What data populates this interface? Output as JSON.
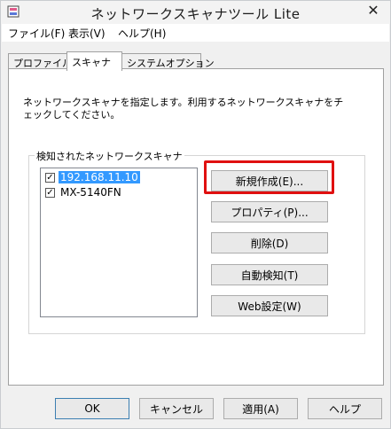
{
  "window": {
    "title": "ネットワークスキャナツール Lite",
    "close_glyph": "✕"
  },
  "menu": [
    "ファイル(F)",
    "表示(V)",
    "ヘルプ(H)"
  ],
  "tabs": [
    "プロファイル",
    "スキャナ",
    "システムオプション"
  ],
  "active_tab": "スキャナ",
  "description": "ネットワークスキャナを指定します。利用するネットワークスキャナをチェックしてください。",
  "group_label": "検知されたネットワークスキャナ",
  "scanners": [
    {
      "label": "192.168.11.10",
      "checked": true,
      "selected": true
    },
    {
      "label": "MX-5140FN",
      "checked": true,
      "selected": false
    }
  ],
  "check_glyph": "✓",
  "action_buttons": {
    "new": "新規作成(E)...",
    "properties": "プロパティ(P)...",
    "delete": "削除(D)",
    "auto_detect": "自動検知(T)",
    "web_settings": "Web設定(W)"
  },
  "dialog_buttons": {
    "ok": "OK",
    "cancel": "キャンセル",
    "apply": "適用(A)",
    "help": "ヘルプ"
  },
  "annotation_color": "#e01010"
}
